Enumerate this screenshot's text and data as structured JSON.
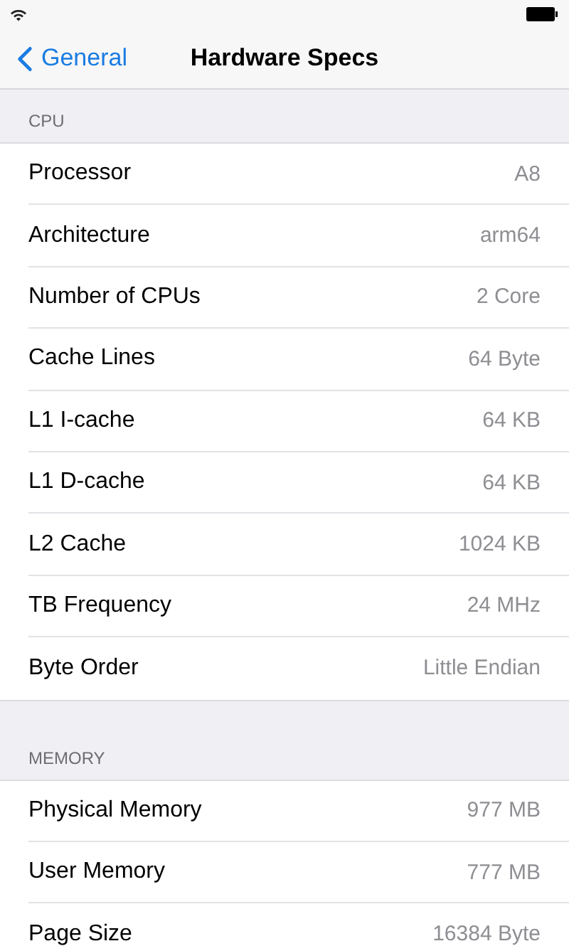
{
  "nav": {
    "back": "General",
    "title": "Hardware Specs"
  },
  "sections": [
    {
      "header": "CPU",
      "rows": [
        {
          "label": "Processor",
          "value": "A8"
        },
        {
          "label": "Architecture",
          "value": "arm64"
        },
        {
          "label": "Number of CPUs",
          "value": "2 Core"
        },
        {
          "label": "Cache Lines",
          "value": "64 Byte"
        },
        {
          "label": "L1 I-cache",
          "value": "64 KB"
        },
        {
          "label": "L1 D-cache",
          "value": "64 KB"
        },
        {
          "label": "L2 Cache",
          "value": "1024 KB"
        },
        {
          "label": "TB Frequency",
          "value": "24 MHz"
        },
        {
          "label": "Byte Order",
          "value": "Little Endian"
        }
      ]
    },
    {
      "header": "MEMORY",
      "rows": [
        {
          "label": "Physical Memory",
          "value": "977 MB"
        },
        {
          "label": "User Memory",
          "value": "777 MB"
        },
        {
          "label": "Page Size",
          "value": "16384 Byte"
        }
      ]
    }
  ]
}
